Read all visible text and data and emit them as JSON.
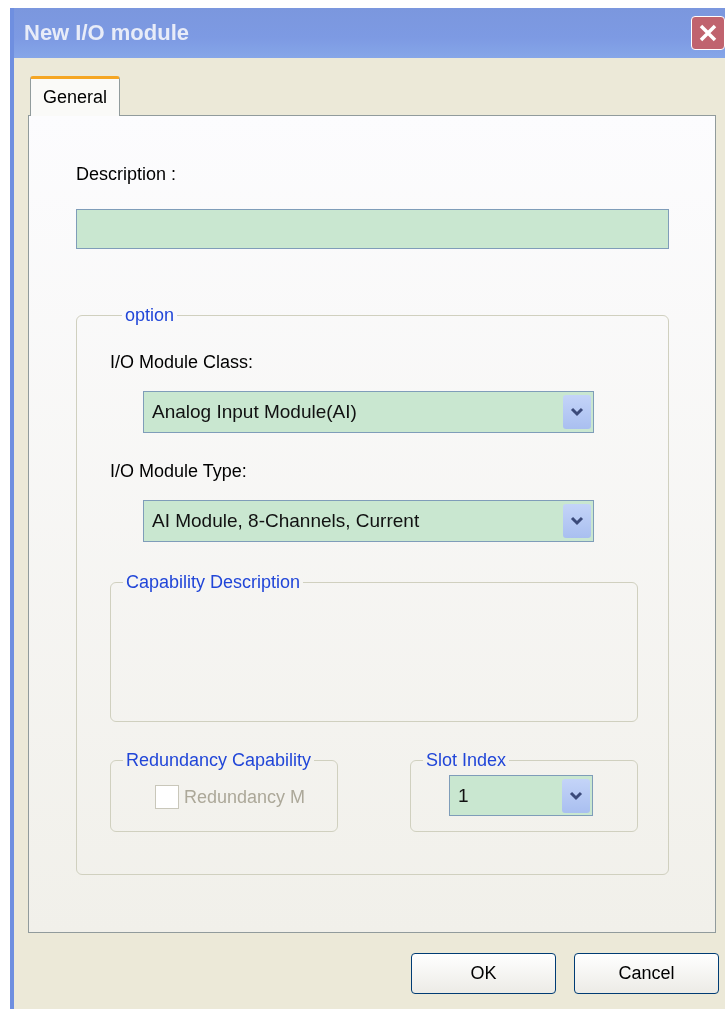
{
  "window": {
    "title": "New I/O module"
  },
  "tabs": [
    {
      "label": "General",
      "selected": true
    }
  ],
  "description": {
    "label": "Description :"
  },
  "option": {
    "legend": "option",
    "module_class": {
      "label": "I/O Module Class:",
      "value": "Analog Input Module(AI)"
    },
    "module_type": {
      "label": "I/O Module Type:",
      "value": "AI Module, 8-Channels, Current"
    },
    "capability": {
      "legend": "Capability Description"
    },
    "redundancy": {
      "legend": "Redundancy Capability",
      "checkbox": {
        "label": "Redundancy M",
        "checked": false,
        "disabled": true
      }
    },
    "slot": {
      "legend": "Slot Index",
      "value": "1"
    }
  },
  "buttons": [
    "OK",
    "Cancel"
  ]
}
